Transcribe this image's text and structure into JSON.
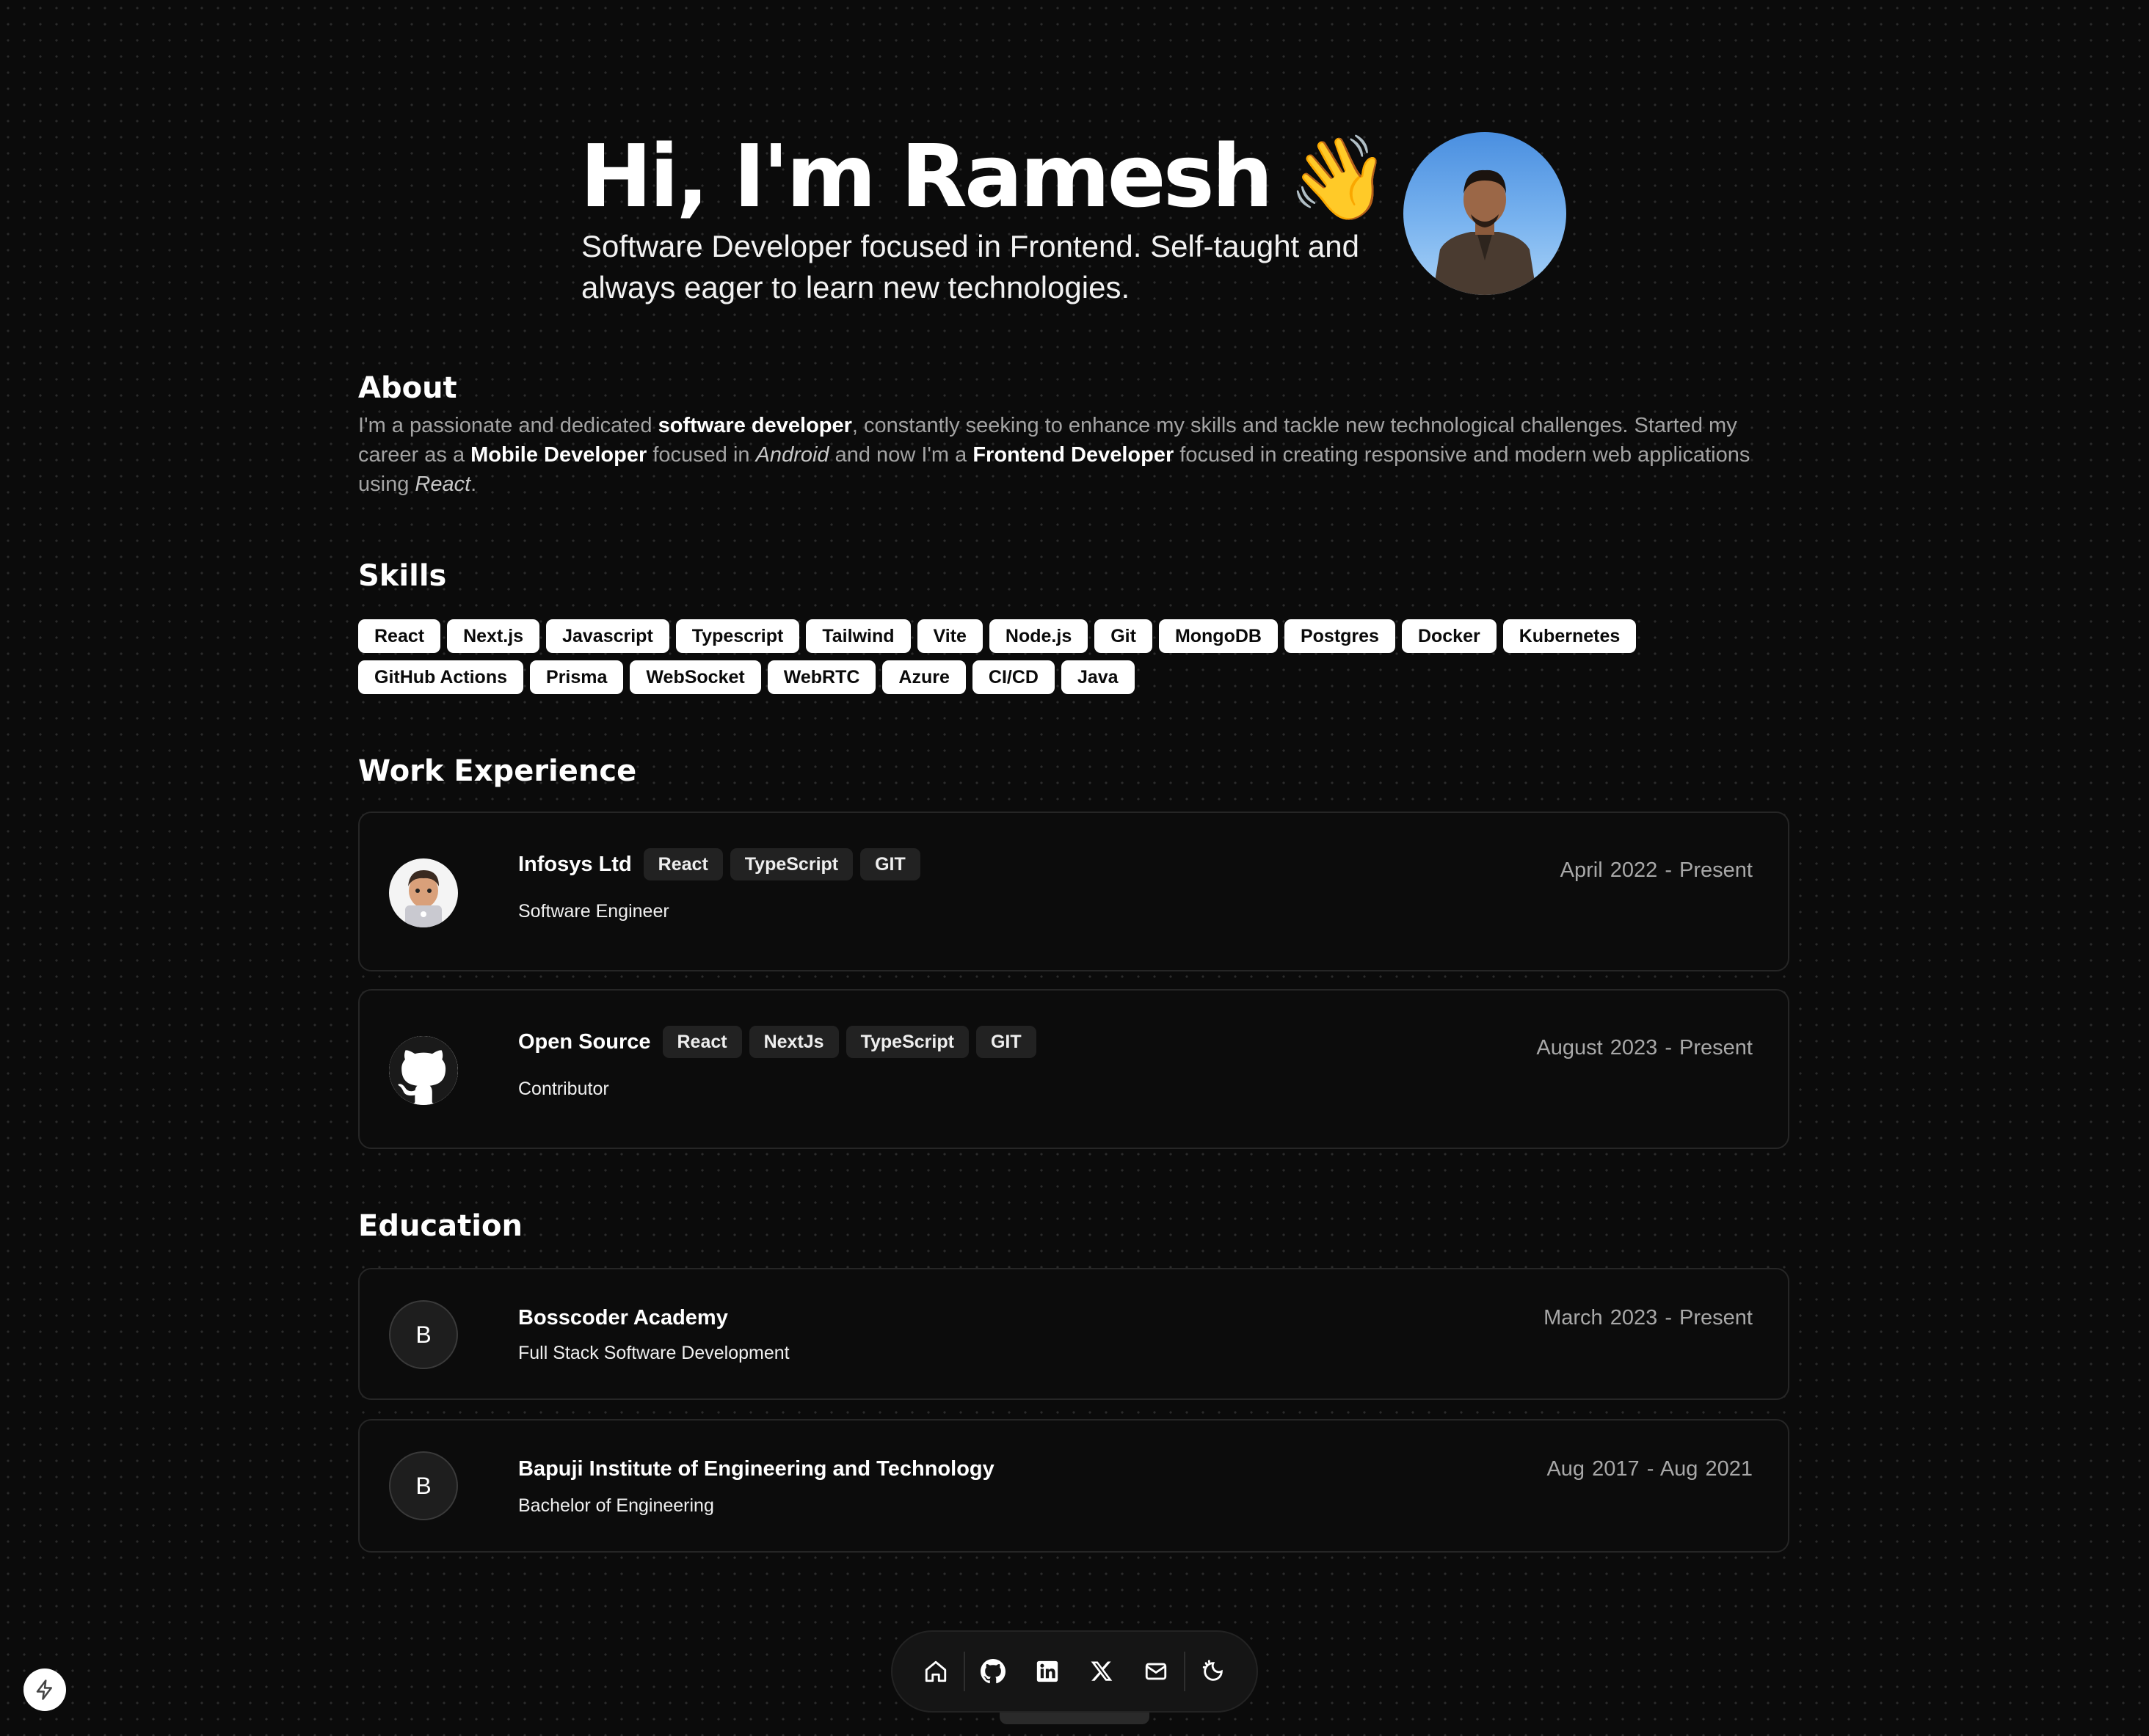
{
  "hero": {
    "greeting": "Hi, I'm Ramesh",
    "wave_emoji": "👋",
    "tagline": "Software Developer focused in Frontend. Self-taught and always eager to learn new technologies."
  },
  "about": {
    "title": "About",
    "text_1": "I'm a passionate and dedicated ",
    "bold_1": "software developer",
    "text_2": ", constantly seeking to enhance my skills and tackle new technological challenges. Started my career as a ",
    "bold_2": "Mobile Developer",
    "text_3": " focused in ",
    "italic_1": "Android",
    "text_4": " and now I'm a ",
    "bold_3": "Frontend Developer",
    "text_5": " focused in creating responsive and modern web applications using ",
    "italic_2": "React",
    "text_6": "."
  },
  "skills": {
    "title": "Skills",
    "items": [
      "React",
      "Next.js",
      "Javascript",
      "Typescript",
      "Tailwind",
      "Vite",
      "Node.js",
      "Git",
      "MongoDB",
      "Postgres",
      "Docker",
      "Kubernetes",
      "GitHub Actions",
      "Prisma",
      "WebSocket",
      "WebRTC",
      "Azure",
      "CI/CD",
      "Java"
    ]
  },
  "work": {
    "title": "Work Experience",
    "items": [
      {
        "company": "Infosys Ltd",
        "tags": [
          "React",
          "TypeScript",
          "GIT"
        ],
        "role": "Software Engineer",
        "start": "April 2022",
        "sep": "-",
        "end": "Present",
        "logo_icon": "memoji-avatar-icon"
      },
      {
        "company": "Open Source",
        "tags": [
          "React",
          "NextJs",
          "TypeScript",
          "GIT"
        ],
        "role": "Contributor",
        "start": "August 2023",
        "sep": "-",
        "end": "Present",
        "logo_icon": "github-icon"
      }
    ]
  },
  "education": {
    "title": "Education",
    "items": [
      {
        "school": "Bosscoder Academy",
        "degree": "Full Stack Software Development",
        "letter": "B",
        "start": "March 2023",
        "sep": "-",
        "end": "Present"
      },
      {
        "school": "Bapuji Institute of Engineering and Technology",
        "degree": "Bachelor of Engineering",
        "letter": "B",
        "start": "Aug 2017",
        "sep": "-",
        "end": "Aug 2021"
      }
    ]
  },
  "dock": {
    "items": [
      "home-icon",
      "github-icon",
      "linkedin-icon",
      "x-icon",
      "mail-icon",
      "theme-toggle-icon"
    ]
  },
  "colors": {
    "background": "#0b0b0b",
    "card_background": "#0c0c0c",
    "card_border": "#262626",
    "skill_badge": "#ffffff",
    "tag_badge": "#222222",
    "muted_text": "#a3a3a3"
  }
}
